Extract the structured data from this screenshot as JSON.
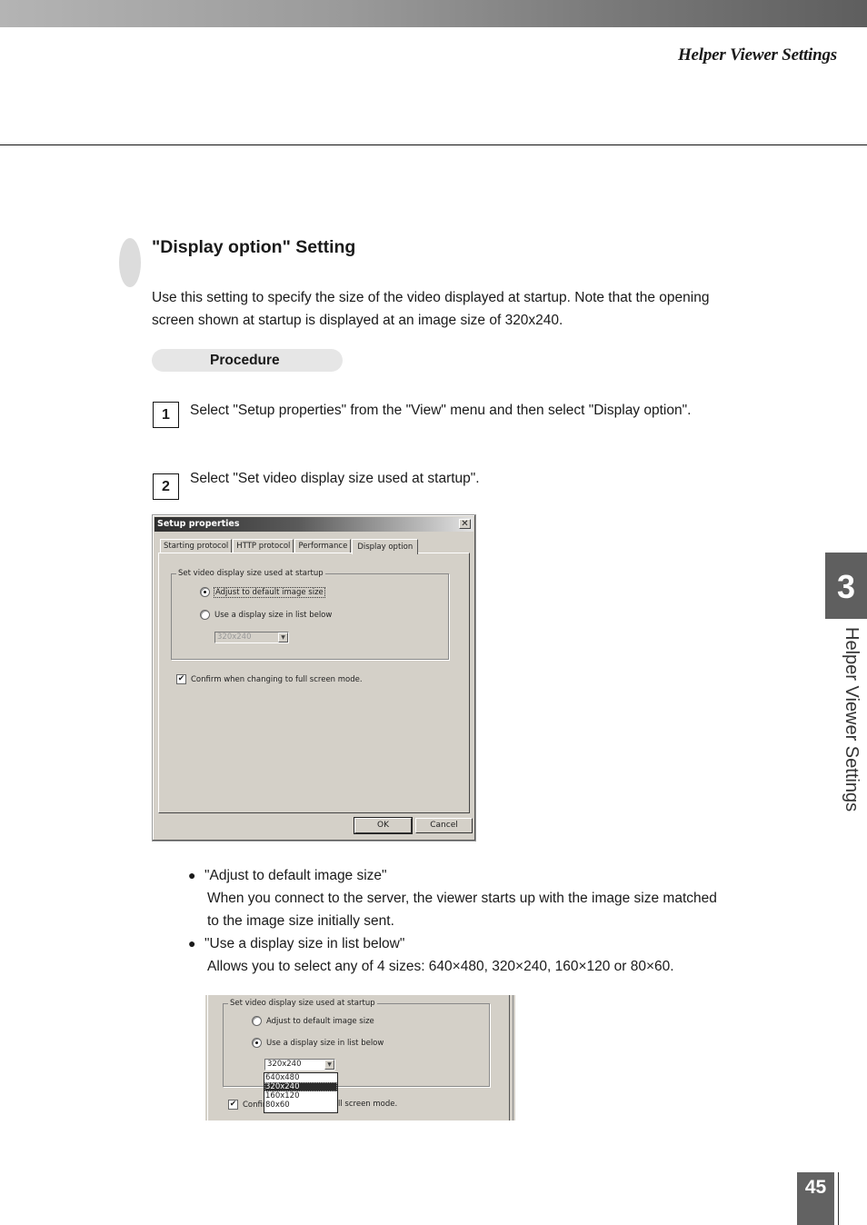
{
  "header": {
    "running_title": "Helper Viewer Settings"
  },
  "section": {
    "title": "\"Display option\" Setting",
    "intro_line1": "Use this setting to specify the size of the video displayed at startup. Note that the opening",
    "intro_line2": "screen shown at startup is displayed at an image size of 320x240.",
    "procedure_label": "Procedure"
  },
  "steps": [
    {
      "number": "1",
      "text": "Select \"Setup properties\" from the \"View\" menu and then select \"Display option\"."
    },
    {
      "number": "2",
      "text": "Select \"Set video display size used at startup\"."
    }
  ],
  "dialog": {
    "title": "Setup properties",
    "close_glyph": "✕",
    "tabs": [
      "Starting protocol",
      "HTTP protocol",
      "Performance",
      "Display option"
    ],
    "active_tab": "Display option",
    "group_label": "Set video display size used at startup",
    "radio_default": {
      "label": "Adjust to default image size",
      "selected": true
    },
    "radio_list": {
      "label": "Use a display size in list below",
      "selected": false
    },
    "combo_value": "320x240",
    "combo_arrow": "▼",
    "checkbox": {
      "label": "Confirm when changing to full screen mode.",
      "checked": true,
      "glyph": "✔"
    },
    "ok_label": "OK",
    "cancel_label": "Cancel"
  },
  "bullets": [
    {
      "dot": "●",
      "title": "\"Adjust to default image size\"",
      "line1": "When you connect to the server, the viewer starts up with the image size matched",
      "line2": "to the image size initially sent."
    },
    {
      "dot": "●",
      "title": "\"Use a display size in list below\"",
      "line1": "Allows you to select any of 4 sizes: 640×480, 320×240, 160×120 or 80×60.",
      "line2": ""
    }
  ],
  "crop_dialog": {
    "group_label": "Set video display size used at startup",
    "radio_default": {
      "label": "Adjust to default image size",
      "selected": false
    },
    "radio_list": {
      "label": "Use a display size in list below",
      "selected": true
    },
    "combo_value": "320x240",
    "combo_arrow": "▼",
    "options": [
      "640x480",
      "320x240",
      "160x120",
      "80x60"
    ],
    "highlighted_option": "320x240",
    "checkbox_left": "Confirm",
    "checkbox_right": "ll screen mode.",
    "checkbox_glyph": "✔"
  },
  "side_tab": {
    "chapter_number": "3",
    "chapter_label": "Helper Viewer Settings"
  },
  "footer": {
    "page_number": "45"
  }
}
